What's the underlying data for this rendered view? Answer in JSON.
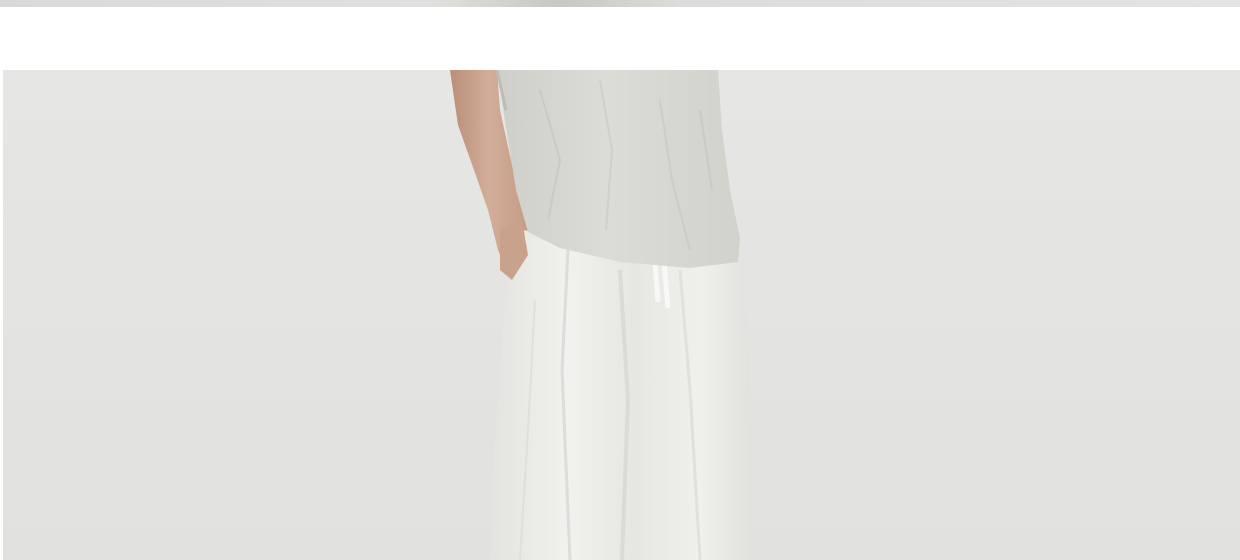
{
  "image": {
    "subject": "model-white-outfit",
    "background_color": "#e4e4e2",
    "shirt_color": "#d8d8d3",
    "pants_color": "#ecece9",
    "skin_color": "#caa590"
  }
}
